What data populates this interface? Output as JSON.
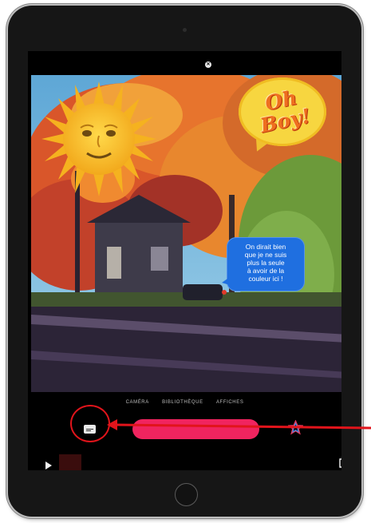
{
  "device": "iPad",
  "overlays": {
    "speech_bubble_text": "On dirait bien\nque je ne suis\nplus la seule\nà avoir de la\ncouleur ici !",
    "oh_boy_sticker_text": "Oh Boy!",
    "sun_sticker": "sun-with-face-emoji"
  },
  "mode_tabs": [
    "CAMÉRA",
    "BIBLIOTHÈQUE",
    "AFFICHES"
  ],
  "toolbar": {
    "captions_icon": "captions-icon",
    "star_icon": "star-icon",
    "play_icon": "play-icon",
    "share_icon": "share-icon"
  },
  "annotation": {
    "highlight_color": "#e1141b",
    "target": "captions-button"
  },
  "colors": {
    "record": "#f0245f",
    "speech_bubble": "#1f6fe0",
    "sticker_yellow": "#f7d640",
    "sticker_orange": "#ef6f1f"
  }
}
